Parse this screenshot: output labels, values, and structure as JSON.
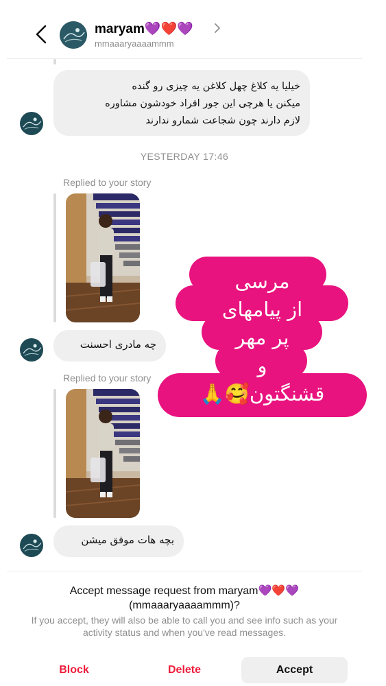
{
  "header": {
    "username": "maryam💜❤️💜",
    "handle": "mmaaaryaaaammm"
  },
  "messages": [
    {
      "lines": [
        "خیلیا یه کلاغ چهل کلاغن یه چیزی رو گنده",
        "میکنن یا هرچی این جور افراد خودشون مشاوره",
        "لازم دارند چون شجاعت شمارو ندارند"
      ]
    },
    {
      "text": "چه مادری احسنت"
    },
    {
      "text": "بچه هات موفق میشن"
    }
  ],
  "timestamp": "YESTERDAY 17:46",
  "story_replies": [
    {
      "label": "Replied to your story"
    },
    {
      "label": "Replied to your story"
    }
  ],
  "sticker": {
    "lines": [
      "مرسی",
      "از پیامهای",
      "پر مهر",
      "و",
      "قشنگتون🥰🙏"
    ],
    "color": "#e8137f"
  },
  "request": {
    "title_line1": "Accept message request from maryam💜❤️💜",
    "title_line2": "(mmaaaryaaaammm)?",
    "description": "If you accept, they will also be able to call you and see info such as your activity status and when you've read messages.",
    "block_label": "Block",
    "delete_label": "Delete",
    "accept_label": "Accept"
  },
  "icons": {
    "back": "back-arrow-icon",
    "chevron": "chevron-right-icon"
  },
  "colors": {
    "danger": "#ed1c3a",
    "bubble": "#efefef",
    "muted": "#8e8e8e"
  }
}
